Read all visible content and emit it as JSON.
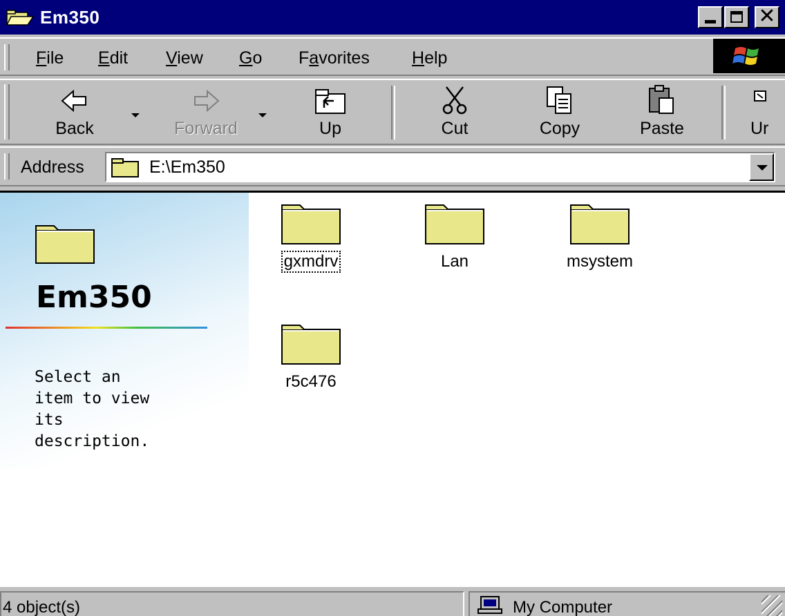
{
  "window": {
    "title": "Em350",
    "icon": "folder-open-icon"
  },
  "menu": {
    "items": [
      {
        "label": "File",
        "accel": "F"
      },
      {
        "label": "Edit",
        "accel": "E"
      },
      {
        "label": "View",
        "accel": "V"
      },
      {
        "label": "Go",
        "accel": "G"
      },
      {
        "label": "Favorites",
        "accel": "a"
      },
      {
        "label": "Help",
        "accel": "H"
      }
    ]
  },
  "toolbar": {
    "back": "Back",
    "forward": "Forward",
    "up": "Up",
    "cut": "Cut",
    "copy": "Copy",
    "paste": "Paste",
    "undo": "Ur"
  },
  "address": {
    "label": "Address",
    "value": "E:\\Em350"
  },
  "panel": {
    "title": "Em350",
    "description": "Select an\nitem to view\nits\ndescription."
  },
  "files": [
    {
      "name": "gxmdrv",
      "type": "folder",
      "focused": true
    },
    {
      "name": "Lan",
      "type": "folder",
      "focused": false
    },
    {
      "name": "msystem",
      "type": "folder",
      "focused": false
    },
    {
      "name": "r5c476",
      "type": "folder",
      "focused": false
    }
  ],
  "status": {
    "count": "4 object(s)",
    "zone": "My Computer"
  },
  "colors": {
    "title_bar": "#00007b",
    "folder_fill": "#e8e88a",
    "chrome": "#c0c0c0"
  }
}
